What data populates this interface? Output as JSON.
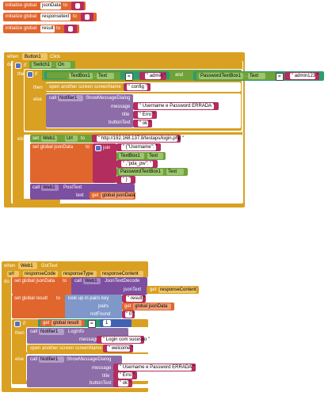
{
  "globals": [
    {
      "kw": "initialize global",
      "name": "jsonData",
      "to": "to",
      "quote": "\"\""
    },
    {
      "kw": "initialize global",
      "name": "responsetext",
      "to": "to",
      "quote": "\"\""
    },
    {
      "kw": "initialize global",
      "name": "result",
      "to": "to",
      "quote": "\"\""
    }
  ],
  "click": {
    "when": "when",
    "comp": "Button1",
    "evt": "Click",
    "do": "do",
    "if": "if",
    "sw": "Switch1",
    "dot": ".",
    "on": "On",
    "then": "then",
    "if2": "if",
    "tb1": "TextBox1",
    "text": "Text",
    "eq": "=",
    "admin": "\" admin \"",
    "and": "and",
    "ptb1": "PasswordTextBox1",
    "pwd": "\" admin123 \"",
    "then2": "then",
    "openscr": "open another screen  screenName",
    "config": "\" config \"",
    "else1": "else",
    "call": "call",
    "noti": "Notifier1",
    "smd": "ShowMessageDialog",
    "message": "message",
    "msg1": "\" Username e Password ERRADA \"",
    "title": "title",
    "erro": "\" Erro \"",
    "btn": "buttonText",
    "ok": "\" ok \"",
    "else2": "else",
    "set": "set",
    "web": "Web1",
    "url": "Url",
    "to": "to",
    "urlval": "\" http://192.168.137.8/testaps/login.php \"",
    "setg": "set global jsonData",
    "to2": "to",
    "join": "join",
    "j1": "\" {\"Username\": \"",
    "j2tb": "TextBox1",
    "j2t": "Text",
    "j3": "\" ,\"pda_pw\": \"",
    "j4tb": "PasswordTextBox1",
    "j4t": "Text",
    "j5": "\" } \"",
    "callweb": "call",
    "web2": "Web1",
    "post": "PostText",
    "textkw": "text",
    "getg": "get",
    "gjd": "global jsonData"
  },
  "got": {
    "when": "when",
    "comp": "Web1",
    "evt": "GotText",
    "p1": "url",
    "p2": "responseCode",
    "p3": "responseType",
    "p4": "responseContent",
    "do": "do",
    "setg": "set global jsonData",
    "to": "to",
    "call": "call",
    "web": "Web1",
    "jtd": "JsonTextDecode",
    "jsonText": "jsonText",
    "get": "get",
    "rc": "responseContent",
    "setr": "set global result",
    "to2": "to",
    "lookup": "look up in pairs  key",
    "resultq": "\" result \"",
    "pairs": "pairs",
    "getg": "get",
    "gjd": "global jsonData",
    "notFound": "notFound",
    "zero": "\" 0 \"",
    "if": "if",
    "getr": "get",
    "gres": "global result",
    "eq": "=",
    "one": "1",
    "then": "then",
    "call2": "call",
    "noti": "Notifier1",
    "logi": "LogInfo",
    "message": "message",
    "succ": "\" Login com sucesso \"",
    "openscr": "open another screen  screenName",
    "welcome": "\" welcome \"",
    "else": "else",
    "call3": "call",
    "noti2": "Notifier1",
    "smd": "ShowMessageDialog",
    "message2": "message",
    "err": "\" Username e Password ERRADA \"",
    "title": "title",
    "erro": "\" Erro \"",
    "btn": "buttonText",
    "ok": "\" ok \""
  }
}
